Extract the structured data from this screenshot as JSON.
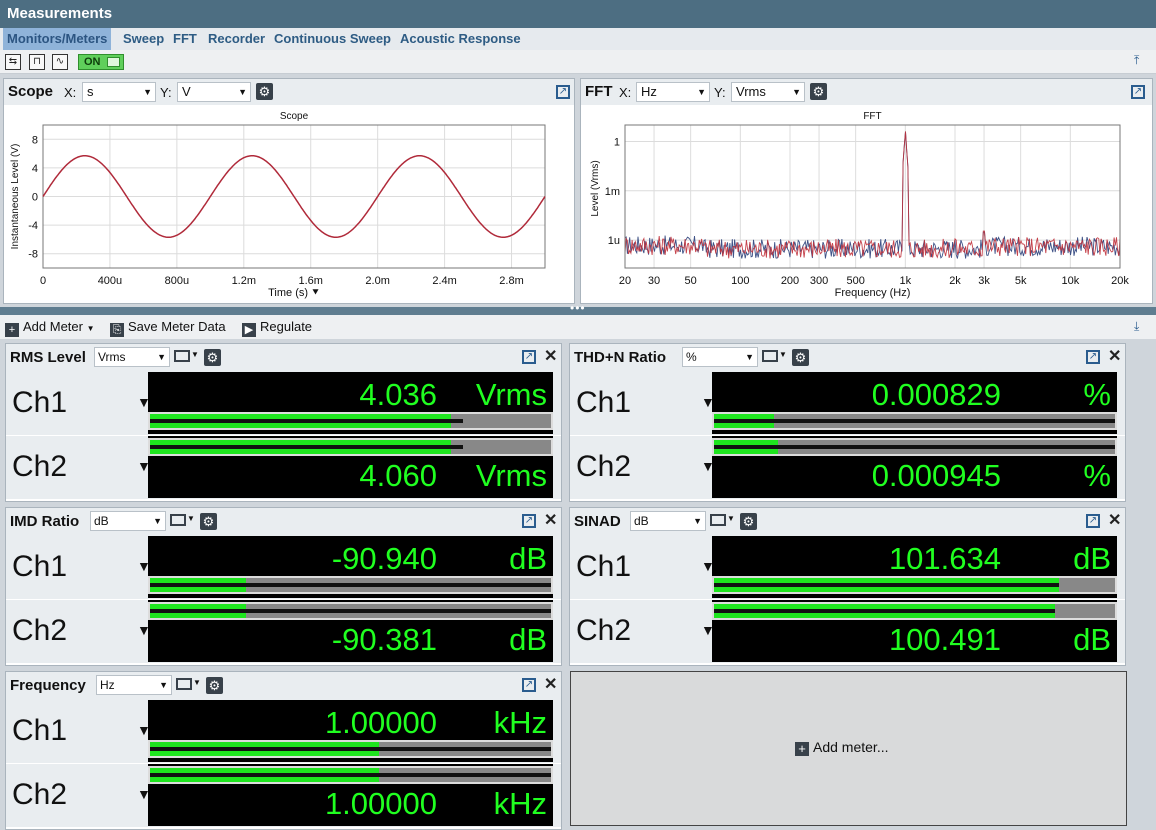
{
  "window": {
    "title": "Measurements"
  },
  "tabs": [
    {
      "label": "Monitors/Meters",
      "active": true
    },
    {
      "label": "Sweep"
    },
    {
      "label": "FFT"
    },
    {
      "label": "Recorder"
    },
    {
      "label": "Continuous Sweep"
    },
    {
      "label": "Acoustic Response"
    }
  ],
  "toolbar": {
    "on_label": "ON"
  },
  "scope": {
    "title": "Scope",
    "x_label": "X:",
    "x_unit": "s",
    "y_label": "Y:",
    "y_unit": "V",
    "chart_data": {
      "type": "line",
      "title": "Scope",
      "xlabel": "Time (s)",
      "ylabel": "Instantaneous Level (V)",
      "xlim": [
        0,
        0.003
      ],
      "ylim": [
        -10,
        10
      ],
      "x_ticks": [
        "0",
        "400u",
        "800u",
        "1.2m",
        "1.6m",
        "2.0m",
        "2.4m",
        "2.8m"
      ],
      "y_ticks": [
        "8",
        "4",
        "0",
        "-4",
        "-8"
      ],
      "series": [
        {
          "color": "#b02a3a",
          "amplitude": 5.7,
          "frequency_hz": 1000
        }
      ],
      "grid": true
    }
  },
  "fft": {
    "title": "FFT",
    "x_label": "X:",
    "x_unit": "Hz",
    "y_label": "Y:",
    "y_unit": "Vrms",
    "chart_data": {
      "type": "line",
      "title": "FFT",
      "xlabel": "Frequency (Hz)",
      "ylabel": "Level (Vrms)",
      "x_scale": "log",
      "y_scale": "log",
      "xlim": [
        20,
        20000
      ],
      "ylim": [
        2e-08,
        10
      ],
      "x_ticks": [
        "20",
        "30",
        "50",
        "100",
        "200",
        "300",
        "500",
        "1k",
        "2k",
        "3k",
        "5k",
        "10k",
        "20k"
      ],
      "y_ticks": [
        "1",
        "1m",
        "1u"
      ],
      "series": [
        {
          "color": "#2a3f7a",
          "peaks": [
            [
              1000,
              4.04
            ],
            [
              2000,
              1e-06
            ],
            [
              3000,
              3e-06
            ]
          ]
        },
        {
          "color": "#c0303a",
          "peaks": [
            [
              1000,
              4.06
            ],
            [
              2000,
              1.2e-06
            ],
            [
              3000,
              3.5e-06
            ]
          ]
        }
      ],
      "noise_floor": 3e-07,
      "grid": true
    }
  },
  "meters_toolbar": {
    "add_meter": "Add Meter",
    "save_meter_data": "Save Meter Data",
    "regulate": "Regulate"
  },
  "meters": [
    {
      "title": "RMS Level",
      "unit_select": "Vrms",
      "ch1": {
        "label": "Ch1",
        "value": "4.036",
        "unit": "Vrms",
        "level": 0.75,
        "peak": 0.78
      },
      "ch2": {
        "label": "Ch2",
        "value": "4.060",
        "unit": "Vrms",
        "level": 0.75,
        "peak": 0.78
      }
    },
    {
      "title": "THD+N Ratio",
      "unit_select": "%",
      "ch1": {
        "label": "Ch1",
        "value": "0.000829",
        "unit": "%",
        "level": 0.15,
        "peak": 1.0
      },
      "ch2": {
        "label": "Ch2",
        "value": "0.000945",
        "unit": "%",
        "level": 0.16,
        "peak": 1.0
      }
    },
    {
      "title": "IMD Ratio",
      "unit_select": "dB",
      "ch1": {
        "label": "Ch1",
        "value": "-90.940",
        "unit": "dB",
        "level": 0.24,
        "peak": 1.0
      },
      "ch2": {
        "label": "Ch2",
        "value": "-90.381",
        "unit": "dB",
        "level": 0.24,
        "peak": 1.0
      }
    },
    {
      "title": "SINAD",
      "unit_select": "dB",
      "ch1": {
        "label": "Ch1",
        "value": "101.634",
        "unit": "dB",
        "level": 0.86,
        "peak": 0.86
      },
      "ch2": {
        "label": "Ch2",
        "value": "100.491",
        "unit": "dB",
        "level": 0.85,
        "peak": 0.85
      }
    },
    {
      "title": "Frequency",
      "unit_select": "Hz",
      "ch1": {
        "label": "Ch1",
        "value": "1.00000",
        "unit": "kHz",
        "level": 0.57,
        "peak": 1.0
      },
      "ch2": {
        "label": "Ch2",
        "value": "1.00000",
        "unit": "kHz",
        "level": 0.57,
        "peak": 1.0
      }
    }
  ],
  "add_meter_tile": {
    "label": "Add meter..."
  },
  "colors": {
    "accent": "#4d6e82",
    "meter_text": "#20ff20",
    "meter_bar": "#1ee51e",
    "tab_active": "#8fb3d9"
  }
}
